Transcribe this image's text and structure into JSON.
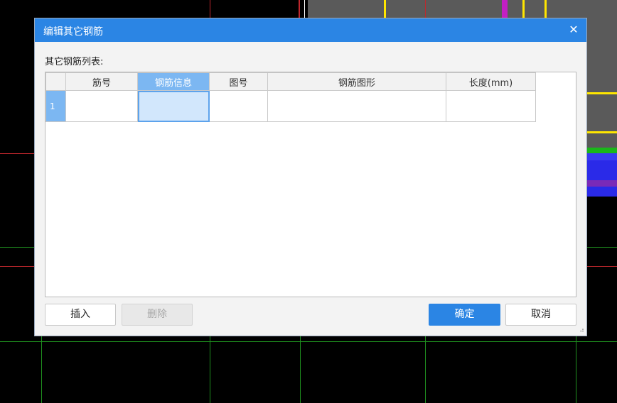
{
  "dialog": {
    "title": "编辑其它钢筋",
    "close_symbol": "✕",
    "list_label": "其它钢筋列表:",
    "columns": [
      "筋号",
      "钢筋信息",
      "图号",
      "钢筋图形",
      "长度(mm)"
    ],
    "active_column": "钢筋信息",
    "rows": [
      {
        "index": "1",
        "cells": [
          "",
          "",
          "",
          "",
          ""
        ]
      }
    ],
    "buttons": {
      "insert": "插入",
      "delete": "删除",
      "ok": "确定",
      "cancel": "取消"
    }
  },
  "colors": {
    "titlebar": "#2b85e4",
    "active_header": "#7cb7f2",
    "selected_cell": "#d2e7fc",
    "primary_button": "#2b85e4"
  }
}
